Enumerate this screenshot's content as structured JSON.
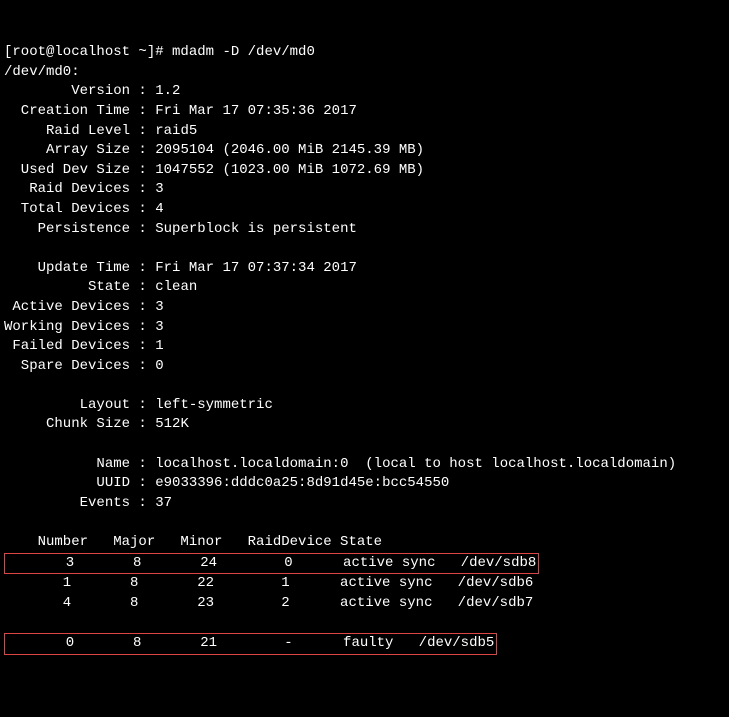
{
  "prompt": "[root@localhost ~]# ",
  "command": "mdadm -D /dev/md0",
  "device_line": "/dev/md0:",
  "rows": [
    {
      "label": "        Version : ",
      "value": "1.2"
    },
    {
      "label": "  Creation Time : ",
      "value": "Fri Mar 17 07:35:36 2017"
    },
    {
      "label": "     Raid Level : ",
      "value": "raid5"
    },
    {
      "label": "     Array Size : ",
      "value": "2095104 (2046.00 MiB 2145.39 MB)"
    },
    {
      "label": "  Used Dev Size : ",
      "value": "1047552 (1023.00 MiB 1072.69 MB)"
    },
    {
      "label": "   Raid Devices : ",
      "value": "3"
    },
    {
      "label": "  Total Devices : ",
      "value": "4"
    },
    {
      "label": "    Persistence : ",
      "value": "Superblock is persistent"
    },
    {
      "label": "",
      "value": ""
    },
    {
      "label": "    Update Time : ",
      "value": "Fri Mar 17 07:37:34 2017"
    },
    {
      "label": "          State : ",
      "value": "clean"
    },
    {
      "label": " Active Devices : ",
      "value": "3"
    },
    {
      "label": "Working Devices : ",
      "value": "3"
    },
    {
      "label": " Failed Devices : ",
      "value": "1"
    },
    {
      "label": "  Spare Devices : ",
      "value": "0"
    },
    {
      "label": "",
      "value": ""
    },
    {
      "label": "         Layout : ",
      "value": "left-symmetric"
    },
    {
      "label": "     Chunk Size : ",
      "value": "512K"
    },
    {
      "label": "",
      "value": ""
    },
    {
      "label": "           Name : ",
      "value": "localhost.localdomain:0  (local to host localhost.localdomain)"
    },
    {
      "label": "           UUID : ",
      "value": "e9033396:dddc0a25:8d91d45e:bcc54550"
    },
    {
      "label": "         Events : ",
      "value": "37"
    }
  ],
  "table_header": "    Number   Major   Minor   RaidDevice State",
  "table_rows": [
    "       3       8       24        0      active sync   /dev/sdb8",
    "       1       8       22        1      active sync   /dev/sdb6",
    "       4       8       23        2      active sync   /dev/sdb7"
  ],
  "faulty_row": "       0       8       21        -      faulty   /dev/sdb5"
}
